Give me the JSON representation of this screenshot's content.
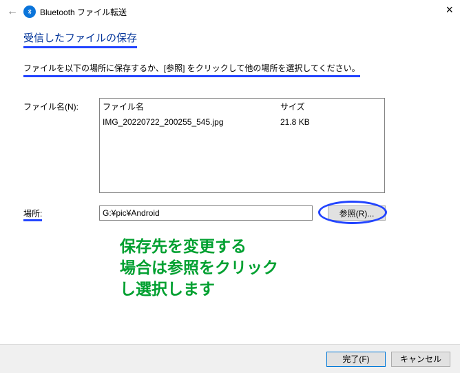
{
  "window": {
    "title": "Bluetooth ファイル転送"
  },
  "heading": "受信したファイルの保存",
  "instruction": "ファイルを以下の場所に保存するか、[参照] をクリックして他の場所を選択してください。",
  "labels": {
    "file_name": "ファイル名(N):",
    "location": "場所:"
  },
  "columns": {
    "name": "ファイル名",
    "size": "サイズ"
  },
  "files": [
    {
      "name": "IMG_20220722_200255_545.jpg",
      "size": "21.8 KB"
    }
  ],
  "location_value": "G:¥pic¥Android",
  "buttons": {
    "browse": "参照(R)...",
    "finish": "完了(F)",
    "cancel": "キャンセル"
  },
  "annotation": {
    "line1": "保存先を変更する",
    "line2": "場合は参照をクリック",
    "line3": "し選択します"
  }
}
